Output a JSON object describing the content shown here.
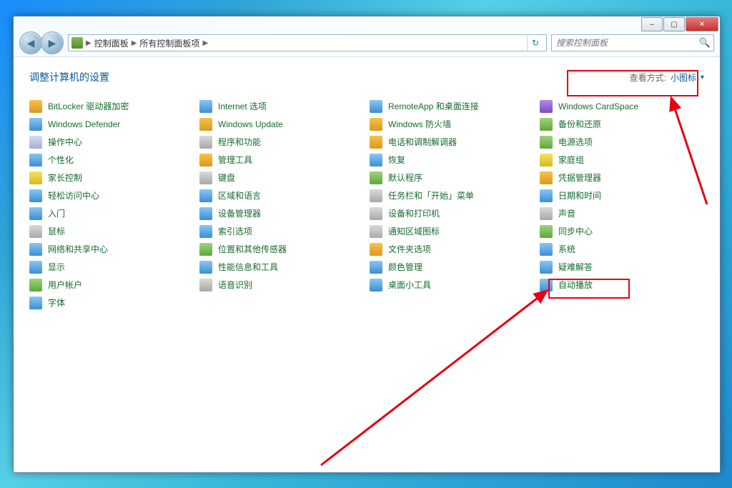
{
  "window": {
    "min_glyph": "–",
    "max_glyph": "▢",
    "close_glyph": "✕"
  },
  "nav": {
    "back_glyph": "◀",
    "fwd_glyph": "▶",
    "crumb1": "控制面板",
    "crumb2": "所有控制面板项",
    "refresh_glyph": "↻"
  },
  "search": {
    "placeholder": "搜索控制面板",
    "icon": "🔍"
  },
  "header": {
    "title": "调整计算机的设置",
    "view_label": "查看方式:",
    "view_mode": "小图标",
    "chev": "▾"
  },
  "cols": [
    [
      {
        "t": "BitLocker 驱动器加密",
        "c": "c1"
      },
      {
        "t": "Windows Defender",
        "c": "c3"
      },
      {
        "t": "操作中心",
        "c": "c4"
      },
      {
        "t": "个性化",
        "c": "c3"
      },
      {
        "t": "家长控制",
        "c": "c8"
      },
      {
        "t": "轻松访问中心",
        "c": "c3"
      },
      {
        "t": "入门",
        "c": "c3"
      },
      {
        "t": "鼠标",
        "c": "c7"
      },
      {
        "t": "网络和共享中心",
        "c": "c3"
      },
      {
        "t": "显示",
        "c": "c3"
      },
      {
        "t": "用户帐户",
        "c": "c2"
      },
      {
        "t": "字体",
        "c": "c3"
      }
    ],
    [
      {
        "t": "Internet 选项",
        "c": "c3"
      },
      {
        "t": "Windows Update",
        "c": "c1"
      },
      {
        "t": "程序和功能",
        "c": "c7"
      },
      {
        "t": "管理工具",
        "c": "c1"
      },
      {
        "t": "键盘",
        "c": "c7"
      },
      {
        "t": "区域和语言",
        "c": "c3"
      },
      {
        "t": "设备管理器",
        "c": "c3"
      },
      {
        "t": "索引选项",
        "c": "c3"
      },
      {
        "t": "位置和其他传感器",
        "c": "c2"
      },
      {
        "t": "性能信息和工具",
        "c": "c3"
      },
      {
        "t": "语音识别",
        "c": "c7"
      }
    ],
    [
      {
        "t": "RemoteApp 和桌面连接",
        "c": "c3"
      },
      {
        "t": "Windows 防火墙",
        "c": "c1"
      },
      {
        "t": "电话和调制解调器",
        "c": "c1"
      },
      {
        "t": "恢复",
        "c": "c3"
      },
      {
        "t": "默认程序",
        "c": "c2"
      },
      {
        "t": "任务栏和「开始」菜单",
        "c": "c7"
      },
      {
        "t": "设备和打印机",
        "c": "c7"
      },
      {
        "t": "通知区域图标",
        "c": "c7"
      },
      {
        "t": "文件夹选项",
        "c": "c1"
      },
      {
        "t": "颜色管理",
        "c": "c3"
      },
      {
        "t": "桌面小工具",
        "c": "c3"
      }
    ],
    [
      {
        "t": "Windows CardSpace",
        "c": "c6"
      },
      {
        "t": "备份和还原",
        "c": "c2"
      },
      {
        "t": "电源选项",
        "c": "c2"
      },
      {
        "t": "家庭组",
        "c": "c8"
      },
      {
        "t": "凭据管理器",
        "c": "c1"
      },
      {
        "t": "日期和时间",
        "c": "c3"
      },
      {
        "t": "声音",
        "c": "c7"
      },
      {
        "t": "同步中心",
        "c": "c2"
      },
      {
        "t": "系统",
        "c": "c3"
      },
      {
        "t": "疑难解答",
        "c": "c3"
      },
      {
        "t": "自动播放",
        "c": "c3"
      }
    ]
  ],
  "highlight_item": "系统"
}
